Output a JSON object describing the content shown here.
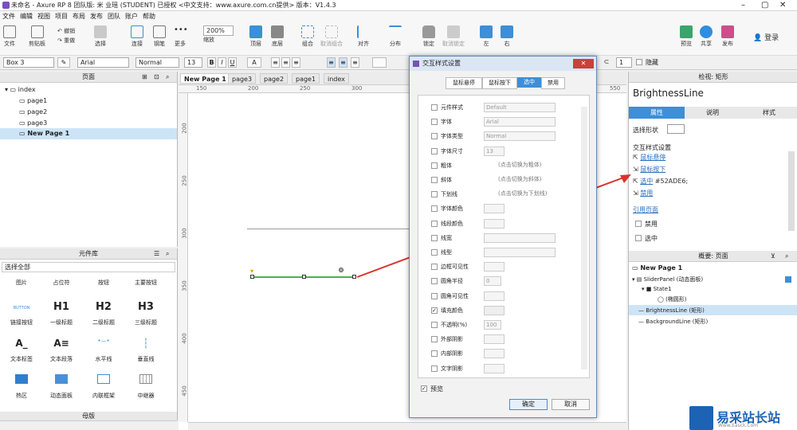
{
  "window": {
    "title": "未命名 - Axure RP 8 团队版: 米 业瑶 (STUDENT) 已授权   <中文支持：www.axure.com.cn提供> 版本：V1.4.3"
  },
  "menu": [
    "文件",
    "编辑",
    "视图",
    "项目",
    "布局",
    "发布",
    "团队",
    "账户",
    "帮助"
  ],
  "toolbar": {
    "file": "文件",
    "clipboard": "剪贴板",
    "undo": "撤销",
    "redo": "重做",
    "select": "选择",
    "connect": "连接",
    "pen": "钢笔",
    "more": "更多",
    "zoom": "200%",
    "zoom_label": "缩放",
    "top": "顶层",
    "bottom": "底层",
    "group": "组合",
    "ungroup": "取消组合",
    "align": "对齐",
    "distribute": "分布",
    "lock": "锁定",
    "unlock": "取消锁定",
    "left": "左",
    "right": "右",
    "preview": "预览",
    "share": "共享",
    "publish": "发布",
    "login": "登录"
  },
  "fmt": {
    "style": "Box 3",
    "font": "Arial",
    "weight": "Normal",
    "size": "13",
    "count": "1",
    "hide": "隐藏"
  },
  "pages_panel": {
    "title": "页面",
    "items": [
      "index",
      "page1",
      "page2",
      "page3",
      "New Page 1"
    ]
  },
  "library": {
    "title": "元件库",
    "select": "选择全部",
    "cats": [
      "图片",
      "占位符",
      "按钮",
      "主要按钮"
    ],
    "items": [
      "链接按钮",
      "一级标题",
      "二级标题",
      "三级标题",
      "文本标签",
      "文本段落",
      "水平线",
      "垂直线",
      "热区",
      "动态面板",
      "内联框架",
      "中继器"
    ],
    "btn_text": "BUTTON",
    "h1": "H1",
    "h2": "H2",
    "h3": "H3"
  },
  "masters": {
    "title": "母版"
  },
  "tabs": [
    "New Page 1",
    "page3",
    "page2",
    "page1",
    "index"
  ],
  "ruler": {
    "top": [
      "150",
      "200",
      "250",
      "300",
      "550"
    ],
    "left": [
      "200",
      "250",
      "300",
      "350",
      "400",
      "450"
    ]
  },
  "dialog": {
    "title": "交互样式设置",
    "tabs": [
      "鼠标悬停",
      "鼠标按下",
      "选中",
      "禁用"
    ],
    "rows": [
      {
        "label": "元件样式",
        "val": "Default",
        "checked": false
      },
      {
        "label": "字体",
        "val": "Arial",
        "checked": false
      },
      {
        "label": "字体类型",
        "val": "Normal",
        "checked": false
      },
      {
        "label": "字体尺寸",
        "val": "13",
        "checked": false
      },
      {
        "label": "粗体",
        "val": "(点击切换为粗体)",
        "checked": false
      },
      {
        "label": "斜体",
        "val": "(点击切换为斜体)",
        "checked": false
      },
      {
        "label": "下划线",
        "val": "(点击切换为下划线)",
        "checked": false
      },
      {
        "label": "字体颜色",
        "val": "",
        "checked": false
      },
      {
        "label": "线段颜色",
        "val": "",
        "checked": false
      },
      {
        "label": "线宽",
        "val": "",
        "checked": false
      },
      {
        "label": "线型",
        "val": "",
        "checked": false
      },
      {
        "label": "边框可见性",
        "val": "",
        "checked": false
      },
      {
        "label": "圆角半径",
        "val": "0",
        "checked": false
      },
      {
        "label": "圆角可见性",
        "val": "",
        "checked": false
      },
      {
        "label": "填充颜色",
        "val": "",
        "checked": true
      },
      {
        "label": "不透明(%)",
        "val": "100",
        "checked": false
      },
      {
        "label": "外部阴影",
        "val": "",
        "checked": false
      },
      {
        "label": "内部阴影",
        "val": "",
        "checked": false
      },
      {
        "label": "文字阴影",
        "val": "",
        "checked": false
      }
    ],
    "preview": "预览",
    "ok": "确定",
    "cancel": "取消"
  },
  "inspector": {
    "header": "检视: 矩形",
    "name": "BrightnessLine",
    "tabs": [
      "属性",
      "说明",
      "样式"
    ],
    "shape": "选择形状",
    "interaction": "交互样式设置",
    "hover": "鼠标悬停",
    "down": "鼠标按下",
    "selected": "选中",
    "selected_val": "#52ADE6;",
    "disabled": "禁用",
    "ref": "引用页面",
    "dis_cb": "禁用",
    "sel_cb": "选中"
  },
  "outline": {
    "header": "概要: 页面",
    "items": [
      "New Page 1",
      "SliderPanel (动态面板)",
      "State1",
      "(椭圆形)",
      "BrightnessLine (矩形)",
      "BackgroundLine (矩形)"
    ]
  },
  "watermark": {
    "text": "易采站长站",
    "sub": "Www.Easck.Com"
  },
  "colors": {
    "accent": "#3c8fd8",
    "fill": "#52ADE6",
    "green": "#4caf50",
    "arrow": "#d9342b"
  }
}
